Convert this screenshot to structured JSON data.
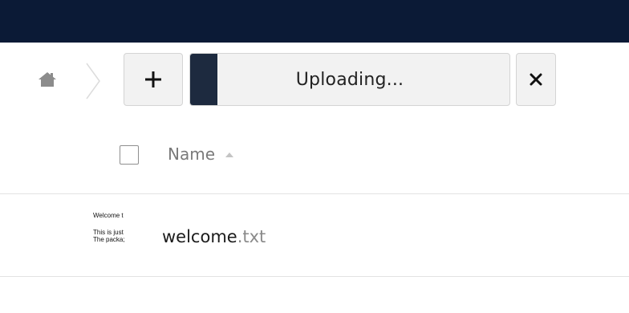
{
  "controls": {
    "home_icon": "home-icon",
    "separator_icon": "chevron-right-icon",
    "new_icon": "plus-icon",
    "upload": {
      "label": "Uploading...",
      "progress": 0.085
    },
    "cancel_icon": "close-icon"
  },
  "table": {
    "columns": {
      "name": "Name",
      "sort_icon": "sort-up-icon"
    },
    "rows": [
      {
        "thumbnail_lines": [
          "Welcome t",
          "This is just",
          "The packa;"
        ],
        "name_base": "welcome",
        "name_ext": ".txt"
      }
    ]
  },
  "colors": {
    "topbar": "#0b1a36",
    "progress_fill": "#1d2a3f",
    "button_bg": "#f2f2f2"
  }
}
